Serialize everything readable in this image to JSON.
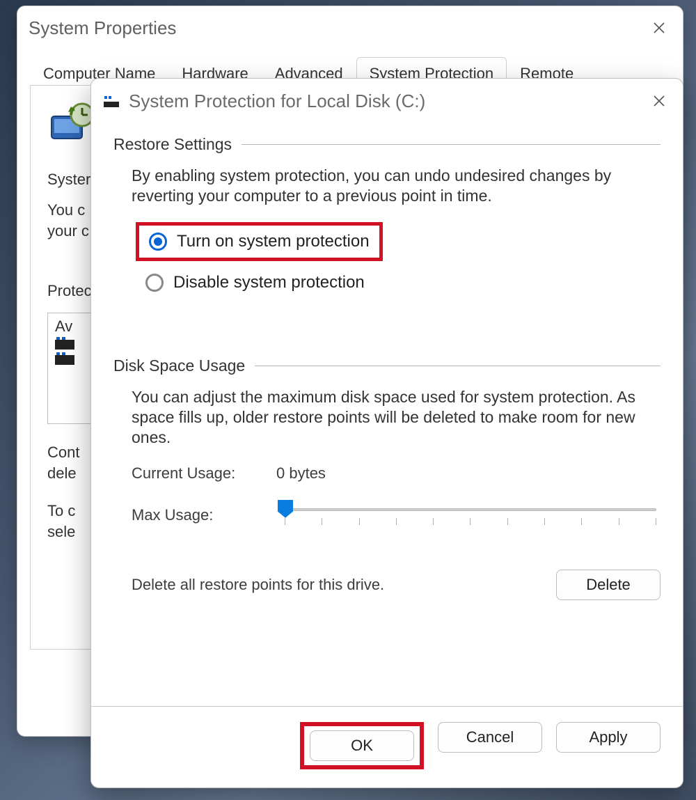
{
  "bg": {
    "title": "System Properties",
    "tabs": [
      "Computer Name",
      "Hardware",
      "Advanced",
      "System Protection",
      "Remote"
    ],
    "selected_tab_index": 3,
    "heading_prefix": "Syster",
    "line1_prefix": "You c",
    "line2_prefix": "your c",
    "protect_prefix": "Protec",
    "drives_header": "Av",
    "config_line1": "Cont",
    "config_line2": "dele",
    "create_line1": "To c",
    "create_line2": "sele"
  },
  "fg": {
    "title": "System Protection for Local Disk (C:)",
    "restore_section": "Restore Settings",
    "restore_desc": "By enabling system protection, you can undo undesired changes by reverting your computer to a previous point in time.",
    "radios": {
      "turn_on": "Turn on system protection",
      "disable": "Disable system protection"
    },
    "disk_section": "Disk Space Usage",
    "disk_desc": "You can adjust the maximum disk space used for system protection. As space fills up, older restore points will be deleted to make room for new ones.",
    "current_usage_label": "Current Usage:",
    "current_usage_value": "0 bytes",
    "max_usage_label": "Max Usage:",
    "delete_text": "Delete all restore points for this drive.",
    "buttons": {
      "delete": "Delete",
      "ok": "OK",
      "cancel": "Cancel",
      "apply": "Apply"
    }
  }
}
